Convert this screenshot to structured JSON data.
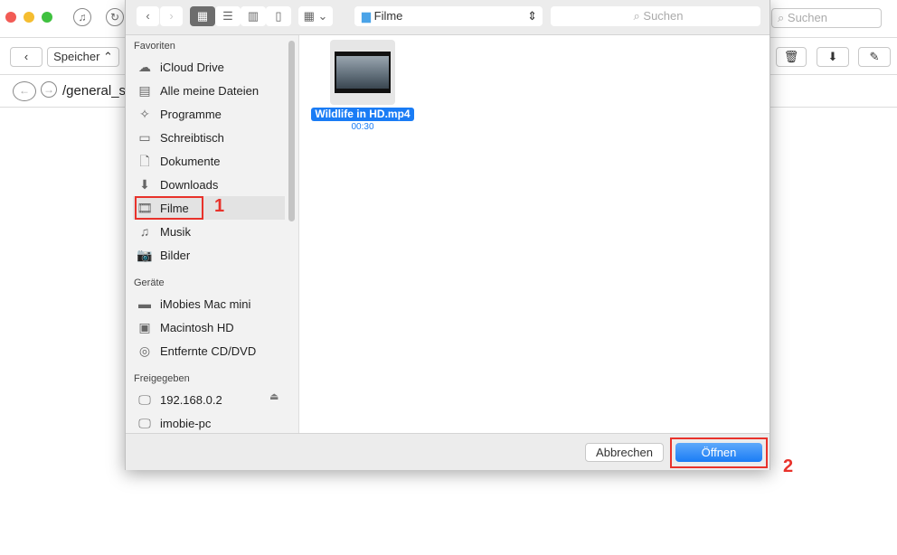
{
  "background_app": {
    "speicher_label": "Speicher ⌃",
    "path": "/general_st",
    "search_placeholder": "Suchen"
  },
  "dialog": {
    "location": "Filme",
    "search_placeholder": "Suchen",
    "sidebar": {
      "sections": [
        {
          "title": "Favoriten",
          "items": [
            {
              "label": "iCloud Drive",
              "icon": "cloud-icon"
            },
            {
              "label": "Alle meine Dateien",
              "icon": "all-files-icon"
            },
            {
              "label": "Programme",
              "icon": "applications-icon"
            },
            {
              "label": "Schreibtisch",
              "icon": "desktop-icon"
            },
            {
              "label": "Dokumente",
              "icon": "documents-icon"
            },
            {
              "label": "Downloads",
              "icon": "downloads-icon"
            },
            {
              "label": "Filme",
              "icon": "movies-icon",
              "selected": true
            },
            {
              "label": "Musik",
              "icon": "music-icon"
            },
            {
              "label": "Bilder",
              "icon": "camera-icon"
            }
          ]
        },
        {
          "title": "Geräte",
          "items": [
            {
              "label": "iMobies Mac mini",
              "icon": "mac-mini-icon"
            },
            {
              "label": "Macintosh HD",
              "icon": "harddisk-icon"
            },
            {
              "label": "Entfernte CD/DVD",
              "icon": "disc-icon"
            }
          ]
        },
        {
          "title": "Freigegeben",
          "items": [
            {
              "label": "192.168.0.2",
              "icon": "display-icon"
            },
            {
              "label": "imobie-pc",
              "icon": "display-icon"
            }
          ]
        }
      ]
    },
    "file": {
      "name": "Wildlife in HD.mp4",
      "duration": "00:30"
    },
    "cancel_label": "Abbrechen",
    "open_label": "Öffnen",
    "accent": "#1a7cf5"
  },
  "annotations": {
    "step1": "1",
    "step2": "2",
    "color": "#e8322b"
  }
}
